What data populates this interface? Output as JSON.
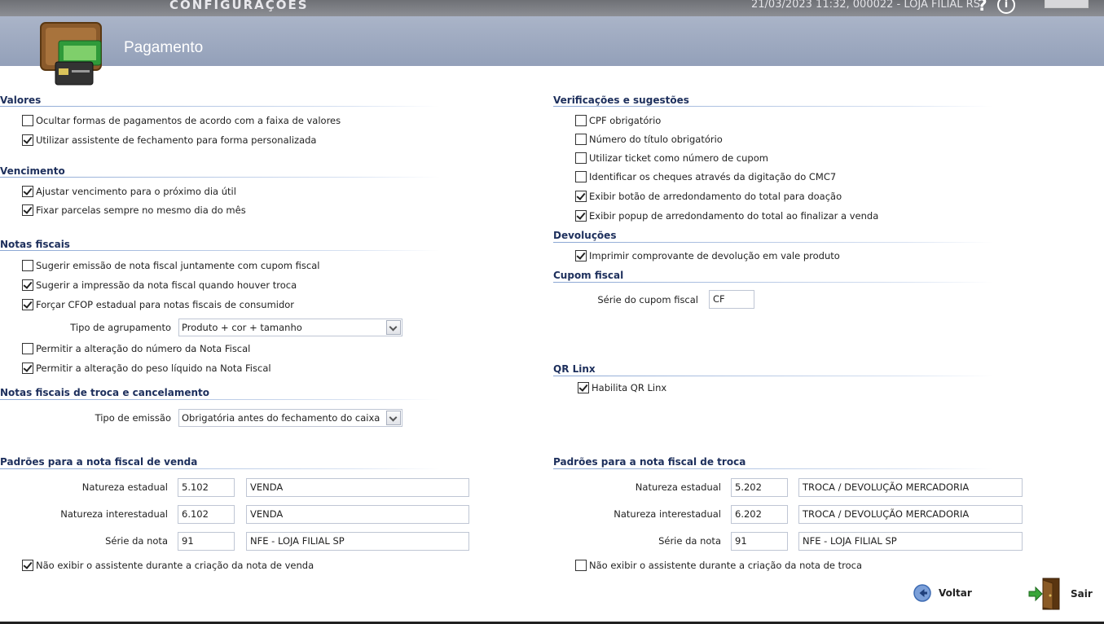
{
  "window": {
    "title": "CONFIGURAÇÕES",
    "info": "21/03/2023 11:32, 000022 - LOJA FILIAL RS.",
    "help_icon": "?",
    "info_icon": "i"
  },
  "header": {
    "title": "Pagamento",
    "icon": "wallet-icon"
  },
  "sections": {
    "valores": "Valores",
    "vencimento": "Vencimento",
    "notas": "Notas fiscais",
    "troca_cancel": "Notas fiscais de troca e cancelamento",
    "padroes_venda": "Padrões para a nota fiscal de venda",
    "verificacoes": "Verificações e sugestões",
    "devolucoes": "Devoluções",
    "cupom": "Cupom fiscal",
    "qr": "QR Linx",
    "padroes_troca": "Padrões para a nota fiscal de troca"
  },
  "checks": {
    "ocultar": {
      "label": "Ocultar formas de pagamentos de acordo com a faixa de valores",
      "checked": false
    },
    "assistente": {
      "label": "Utilizar assistente de fechamento para forma personalizada",
      "checked": true
    },
    "ajustar": {
      "label": "Ajustar vencimento para o próximo dia útil",
      "checked": true
    },
    "fixar": {
      "label": "Fixar parcelas sempre no mesmo dia do mês",
      "checked": true
    },
    "sugerir_emissao": {
      "label": "Sugerir emissão de nota fiscal juntamente com cupom fiscal",
      "checked": false
    },
    "sugerir_impressao": {
      "label": "Sugerir a impressão da nota fiscal quando houver troca",
      "checked": true
    },
    "forcar_cfop": {
      "label": "Forçar CFOP estadual para notas fiscais de consumidor",
      "checked": true
    },
    "permitir_numero": {
      "label": "Permitir a alteração do número da Nota Fiscal",
      "checked": false
    },
    "permitir_peso": {
      "label": "Permitir a alteração do peso líquido na Nota Fiscal",
      "checked": true
    },
    "nao_exibir_venda": {
      "label": "Não exibir o assistente durante a criação da nota de venda",
      "checked": true
    },
    "cpf": {
      "label": "CPF obrigatório",
      "checked": false
    },
    "numero_titulo": {
      "label": "Número do título obrigatório",
      "checked": false
    },
    "ticket": {
      "label": "Utilizar ticket como número de cupom",
      "checked": false
    },
    "cheques": {
      "label": "Identificar os cheques através da digitação do CMC7",
      "checked": false
    },
    "botao_arred": {
      "label": "Exibir botão de arredondamento do total para doação",
      "checked": true
    },
    "popup_arred": {
      "label": "Exibir popup de arredondamento do total ao finalizar a venda",
      "checked": true
    },
    "imprimir_comprovante": {
      "label": "Imprimir comprovante de devolução em vale produto",
      "checked": true
    },
    "qr_linx": {
      "label": "Habilita QR Linx",
      "checked": true
    },
    "nao_exibir_troca": {
      "label": "Não exibir o assistente durante a criação da nota de troca",
      "checked": false
    }
  },
  "fields": {
    "tipo_agrupamento": {
      "label": "Tipo de agrupamento",
      "value": "Produto + cor + tamanho"
    },
    "tipo_emissao": {
      "label": "Tipo de emissão",
      "value": "Obrigatória antes do fechamento do caixa"
    },
    "serie_cupom": {
      "label": "Série do cupom fiscal",
      "value": "CF"
    }
  },
  "venda": {
    "estadual": {
      "label": "Natureza estadual",
      "code": "5.102",
      "desc": "VENDA"
    },
    "interestadual": {
      "label": "Natureza interestadual",
      "code": "6.102",
      "desc": "VENDA"
    },
    "serie": {
      "label": "Série da nota",
      "code": "91",
      "desc": "NFE - LOJA FILIAL SP"
    }
  },
  "troca": {
    "estadual": {
      "label": "Natureza estadual",
      "code": "5.202",
      "desc": "TROCA / DEVOLUÇÃO MERCADORIA"
    },
    "interestadual": {
      "label": "Natureza interestadual",
      "code": "6.202",
      "desc": "TROCA / DEVOLUÇÃO MERCADORIA"
    },
    "serie": {
      "label": "Série da nota",
      "code": "91",
      "desc": "NFE - LOJA FILIAL SP"
    }
  },
  "buttons": {
    "voltar": "Voltar",
    "sair": "Sair"
  },
  "colors": {
    "section_title": "#1d2f5c",
    "banner": "#9aa6bd",
    "topbar": "#7d7f84"
  }
}
